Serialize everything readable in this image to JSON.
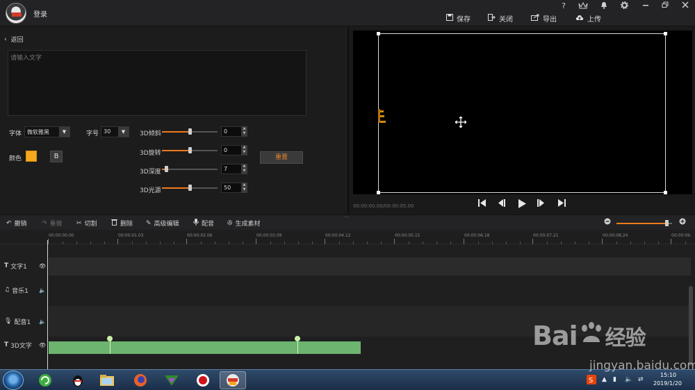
{
  "titlebar": {
    "login": "登录",
    "help_icon": "?",
    "save": "保存",
    "close": "关闭",
    "export": "导出",
    "upload": "上传"
  },
  "editor": {
    "back": "返回",
    "text_placeholder": "请输入文字",
    "font_label": "字体",
    "font_value": "微软雅黑",
    "size_label": "字号",
    "size_value": "30",
    "color_label": "颜色",
    "color_value": "#f5a81c",
    "bold_label": "B",
    "reset": "重置",
    "sliders": [
      {
        "label": "3D倾斜",
        "value": "0",
        "fraction": 0.5
      },
      {
        "label": "3D旋转",
        "value": "0",
        "fraction": 0.5
      },
      {
        "label": "3D深度",
        "value": "7",
        "fraction": 0.07
      },
      {
        "label": "3D光源",
        "value": "50",
        "fraction": 0.5
      }
    ]
  },
  "preview": {
    "timecode": "00:00:00.00/00:00:05.00"
  },
  "toolbar": {
    "undo": "撤销",
    "redo": "重做",
    "cut": "切割",
    "delete": "删除",
    "advanced_edit": "高级编辑",
    "dub": "配音",
    "generate": "生成素材"
  },
  "ruler": {
    "ticks": [
      "00:00:00.00",
      "00:00:01.03",
      "00:00:02.06",
      "00:00:03.09",
      "00:00:04.12",
      "00:00:05.15",
      "00:00:06.18",
      "00:00:07.21",
      "00:00:08.24",
      "00:00:09."
    ]
  },
  "tracks": [
    {
      "name": "文字1"
    },
    {
      "name": "音乐1"
    },
    {
      "name": "配音1"
    },
    {
      "name": "3D文字"
    }
  ],
  "taskbar": {
    "time": "15:10",
    "date": "2019/1/20"
  },
  "watermark": {
    "brand": "Bai",
    "brand_suffix": "经验",
    "url": "jingyan.baidu.com"
  }
}
